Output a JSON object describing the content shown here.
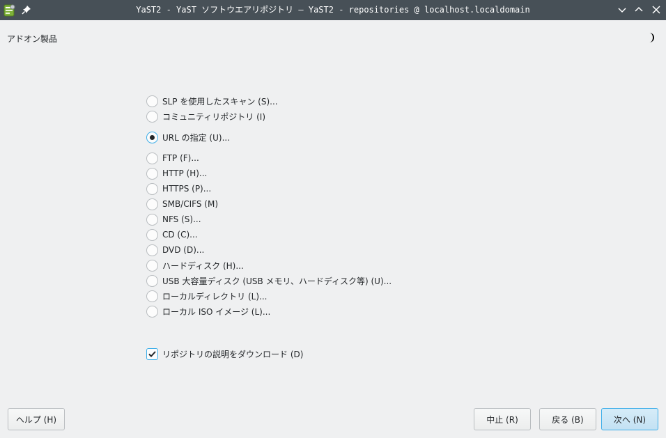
{
  "window": {
    "title": "YaST2 - YaST ソフトウエアリポジトリ — YaST2 - repositories @ localhost.localdomain"
  },
  "header": {
    "title": "アドオン製品"
  },
  "options": [
    {
      "label": "SLP を使用したスキャン (S)...",
      "selected": false
    },
    {
      "label": "コミュニティリポジトリ (I)",
      "selected": false
    },
    {
      "label": "URL の指定 (U)...",
      "selected": true
    },
    {
      "label": "FTP (F)...",
      "selected": false
    },
    {
      "label": "HTTP (H)...",
      "selected": false
    },
    {
      "label": "HTTPS (P)...",
      "selected": false
    },
    {
      "label": "SMB/CIFS (M)",
      "selected": false
    },
    {
      "label": "NFS (S)...",
      "selected": false
    },
    {
      "label": "CD (C)...",
      "selected": false
    },
    {
      "label": "DVD (D)...",
      "selected": false
    },
    {
      "label": "ハードディスク (H)...",
      "selected": false
    },
    {
      "label": "USB 大容量ディスク (USB メモリ、ハードディスク等) (U)...",
      "selected": false
    },
    {
      "label": "ローカルディレクトリ (L)...",
      "selected": false
    },
    {
      "label": "ローカル ISO イメージ (L)...",
      "selected": false
    }
  ],
  "download_description": {
    "label": "リポジトリの説明をダウンロード (D)",
    "checked": true
  },
  "buttons": {
    "help": "ヘルプ (H)",
    "abort": "中止 (R)",
    "back": "戻る (B)",
    "next": "次へ (N)"
  },
  "colors": {
    "titlebar": "#475057",
    "accent": "#3daee9",
    "background": "#eff0f1"
  }
}
